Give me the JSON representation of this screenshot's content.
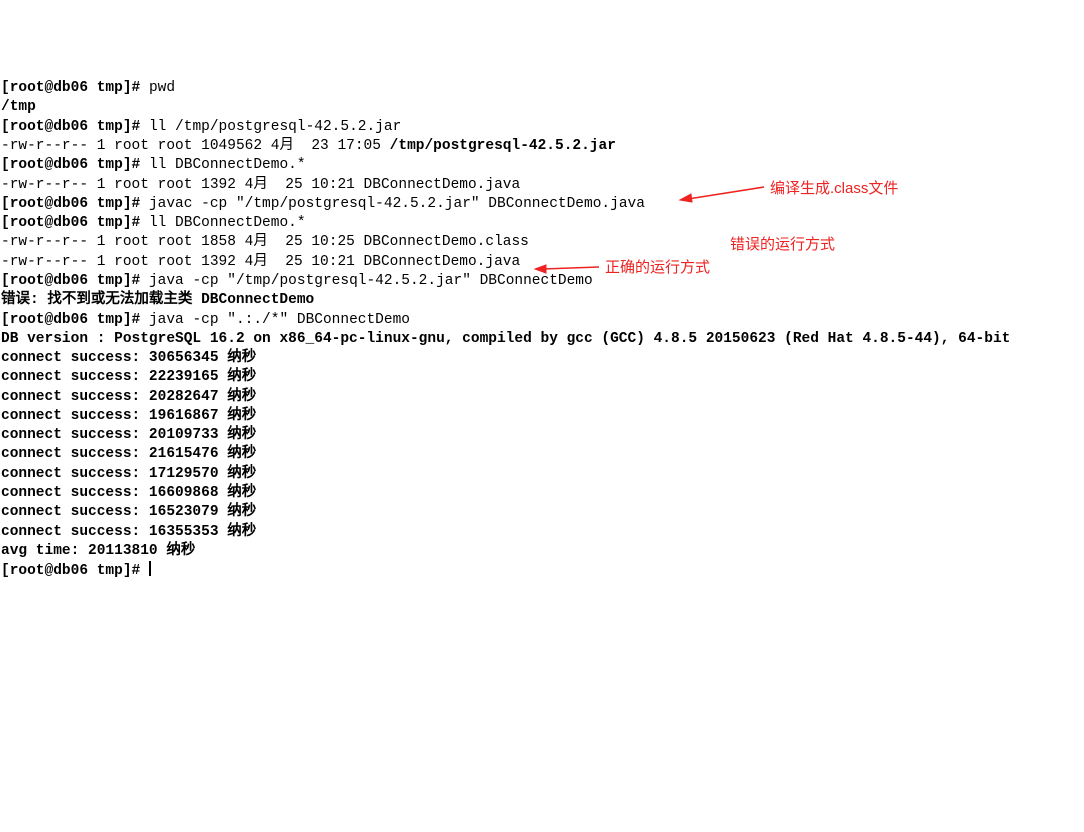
{
  "prompt": "[root@db06 tmp]#",
  "cmd_pwd": "pwd",
  "out_pwd": "/tmp",
  "cmd_ll_pg": "ll /tmp/postgresql-42.5.2.jar",
  "ls_pg_prefix": "-rw-r--r-- 1 root root 1049562 4月  23 17:05 ",
  "ls_pg_file": "/tmp/postgresql-42.5.2.jar",
  "cmd_ll_demo1": "ll DBConnectDemo.*",
  "ls_demo1": "-rw-r--r-- 1 root root 1392 4月  25 10:21 DBConnectDemo.java",
  "cmd_javac": "javac -cp \"/tmp/postgresql-42.5.2.jar\" DBConnectDemo.java",
  "cmd_ll_demo2": "ll DBConnectDemo.*",
  "ls_class": "-rw-r--r-- 1 root root 1858 4月  25 10:25 DBConnectDemo.class",
  "ls_java2": "-rw-r--r-- 1 root root 1392 4月  25 10:21 DBConnectDemo.java",
  "cmd_java_wrong": "java -cp \"/tmp/postgresql-42.5.2.jar\" DBConnectDemo",
  "err_main": "错误: 找不到或无法加载主类 DBConnectDemo",
  "cmd_java_right": "java -cp \".:./*\" DBConnectDemo",
  "dbver": "DB version : PostgreSQL 16.2 on x86_64-pc-linux-gnu, compiled by gcc (GCC) 4.8.5 20150623 (Red Hat 4.8.5-44), 64-bit",
  "connect": [
    "connect success: 30656345 纳秒",
    "connect success: 22239165 纳秒",
    "connect success: 20282647 纳秒",
    "connect success: 19616867 纳秒",
    "connect success: 20109733 纳秒",
    "connect success: 21615476 纳秒",
    "connect success: 17129570 纳秒",
    "connect success: 16609868 纳秒",
    "connect success: 16523079 纳秒",
    "connect success: 16355353 纳秒"
  ],
  "avg": "avg time: 20113810 纳秒",
  "anno_compile": "编译生成.class文件",
  "anno_wrong": "错误的运行方式",
  "anno_right": "正确的运行方式"
}
